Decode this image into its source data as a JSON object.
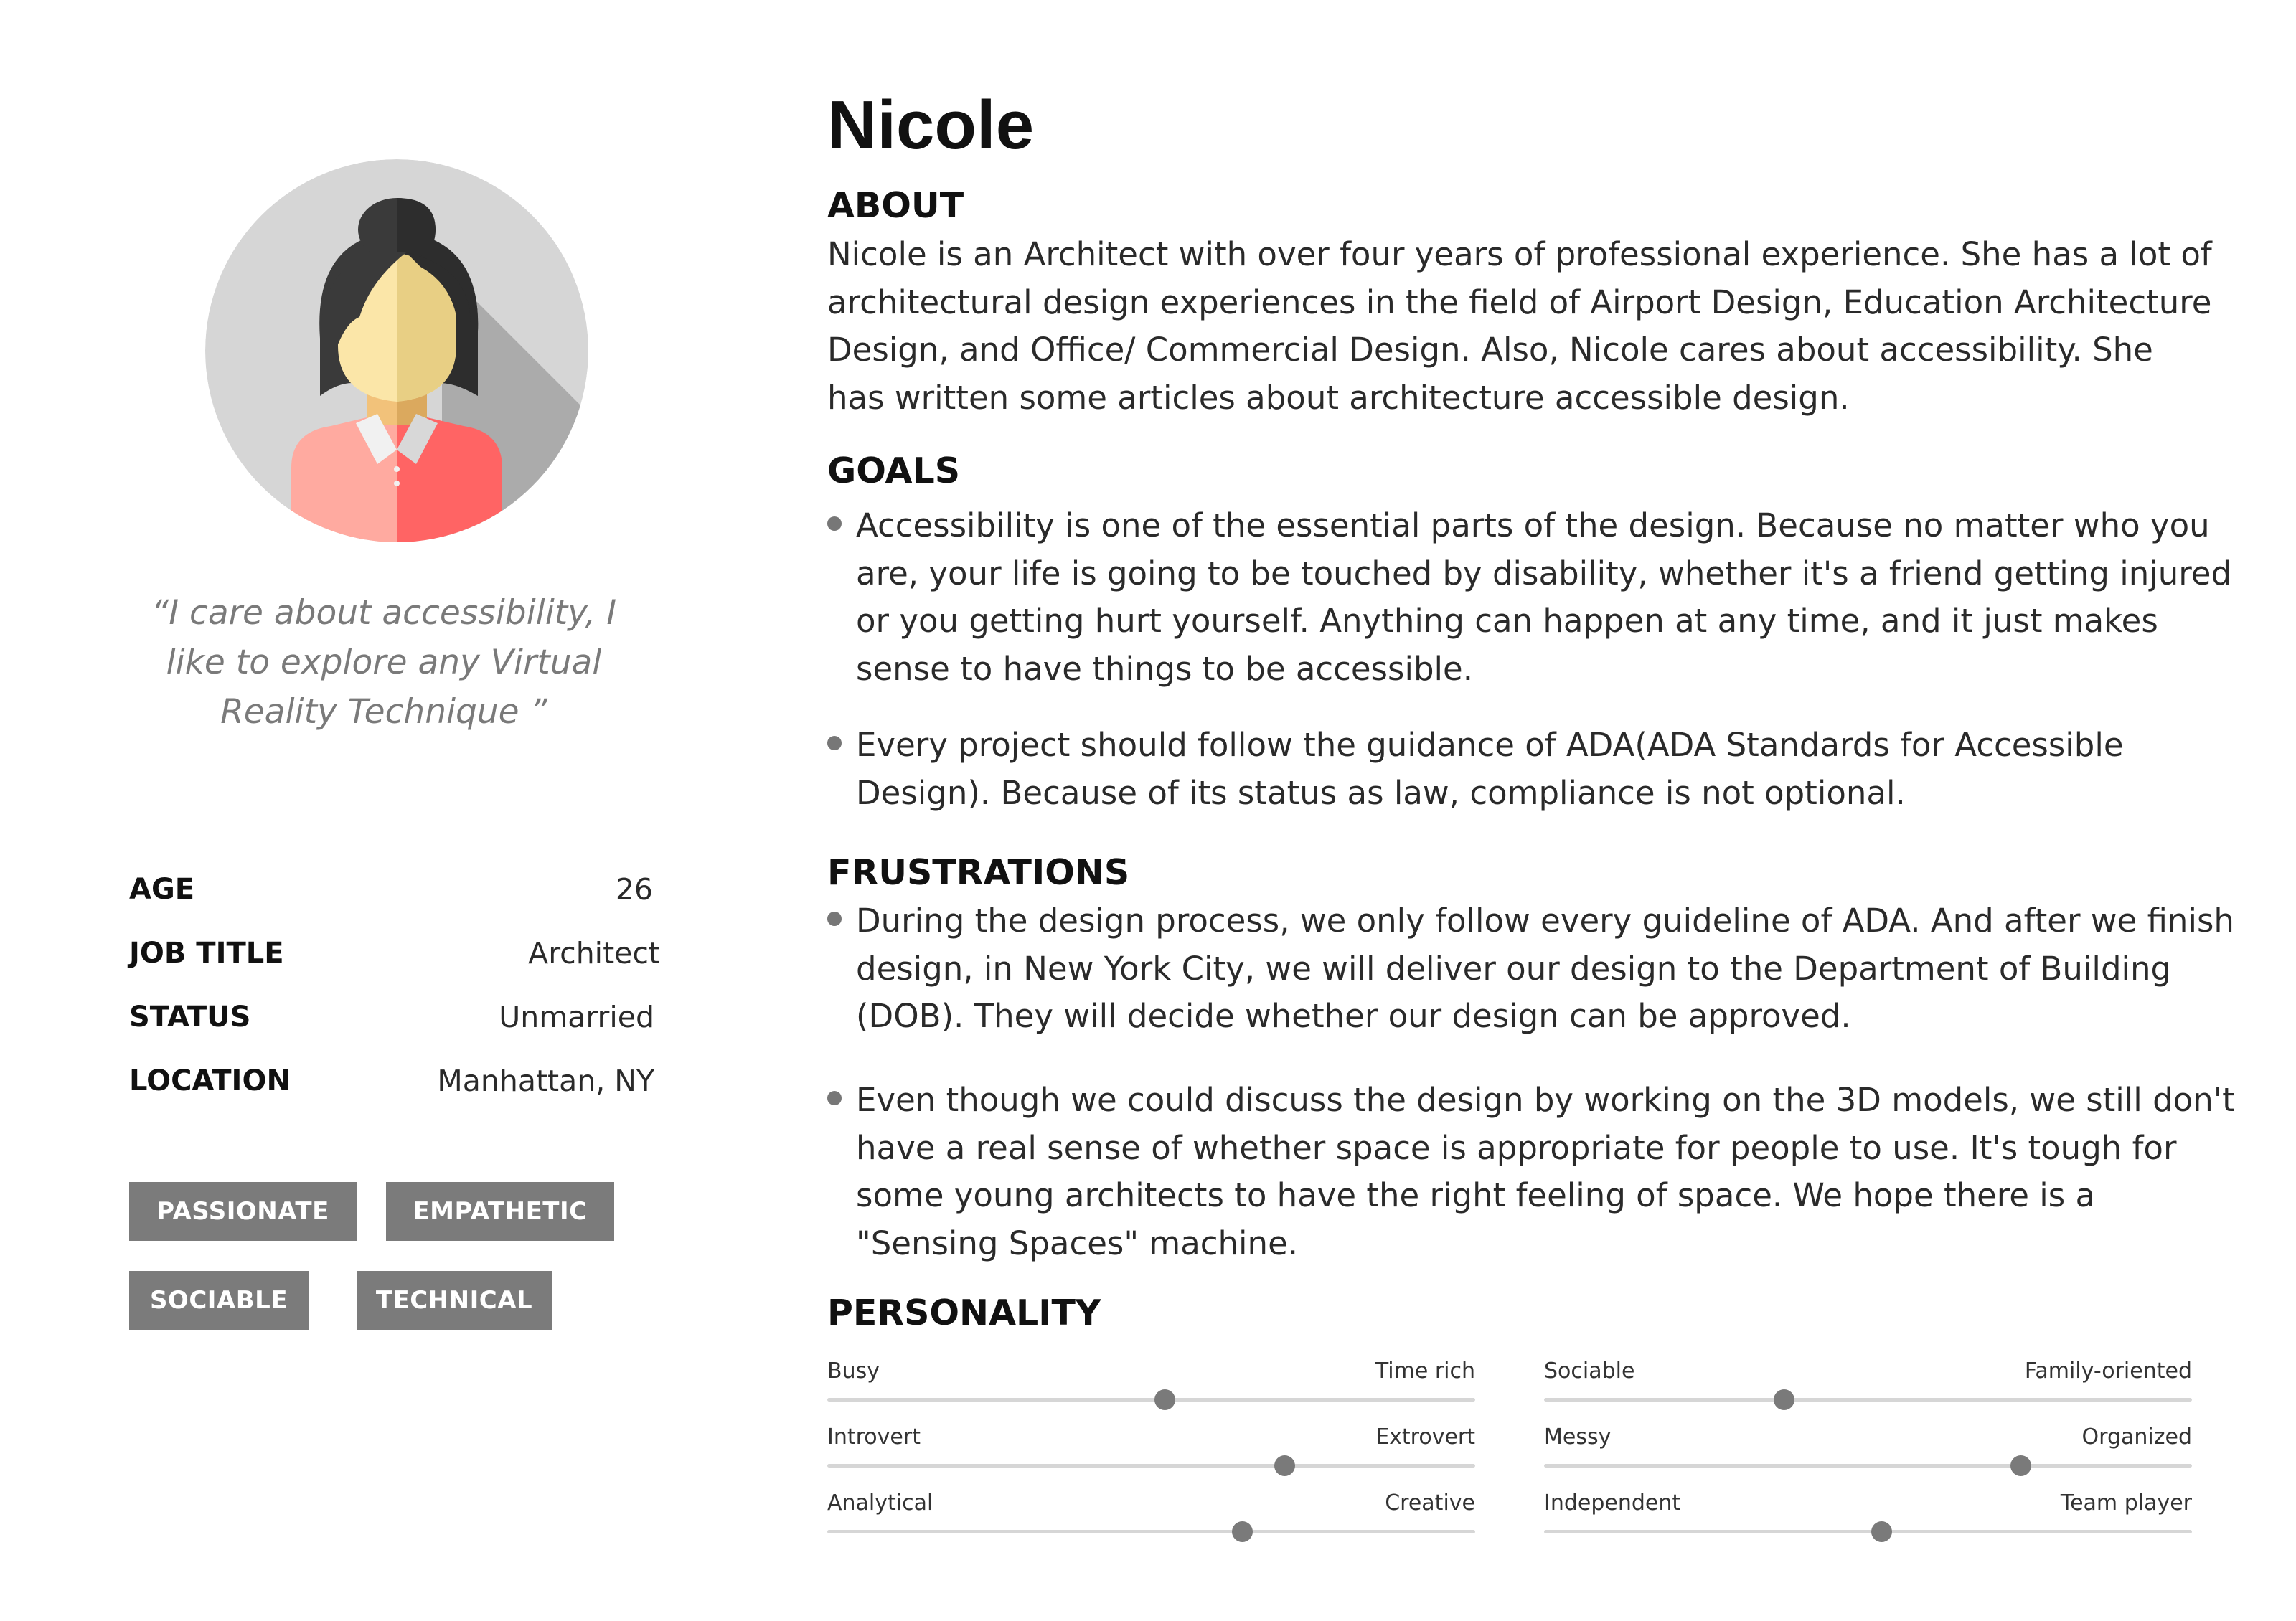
{
  "persona": {
    "name": "Nicole",
    "quote": "“I care about accessibility, I like to explore any Virtual Reality Technique ”"
  },
  "facts": [
    {
      "key": "AGE",
      "value": "26"
    },
    {
      "key": "JOB TITLE",
      "value": "Architect"
    },
    {
      "key": "STATUS",
      "value": "Unmarried"
    },
    {
      "key": "LOCATION",
      "value": "Manhattan, NY"
    }
  ],
  "tags": [
    "PASSIONATE",
    "EMPATHETIC",
    "SOCIABLE",
    "TECHNICAL"
  ],
  "about": {
    "heading": "ABOUT",
    "text": "Nicole is an Architect with over four years of professional experience. She has a lot of architectural design experiences in the field of Airport Design, Education Architecture Design, and Office/ Commercial Design. Also, Nicole cares about accessibility. She has written some articles about architecture accessible design."
  },
  "goals": {
    "heading": "GOALS",
    "items": [
      "Accessibility is one of the essential parts of the design. Because no matter who you are, your life is going to be touched by disability, whether it's a friend getting injured or you getting hurt yourself. Anything can happen at any time, and it just makes sense to have things to be accessible.",
      "Every project should follow the guidance of ADA(ADA Standards for Accessible Design). Because of its status as law, compliance is not optional."
    ]
  },
  "frustrations": {
    "heading": "FRUSTRATIONS",
    "items": [
      "During the design process, we only follow every guideline of ADA. And after we finish design, in New York City,  we will deliver our design to the Department of Building (DOB). They will decide whether our design can be approved.",
      "Even though we could discuss the design by working on the 3D models, we still don't have a real sense of whether space is appropriate for people to use. It's tough for some young architects to have the right feeling of space. We hope there is a \"Sensing Spaces\" machine."
    ]
  },
  "personality": {
    "heading": "PERSONALITY",
    "traits": [
      {
        "left": "Busy",
        "right": "Time rich",
        "value": 0.52
      },
      {
        "left": "Sociable",
        "right": "Family-oriented",
        "value": 0.37
      },
      {
        "left": "Introvert",
        "right": "Extrovert",
        "value": 0.705
      },
      {
        "left": "Messy",
        "right": "Organized",
        "value": 0.735
      },
      {
        "left": "Analytical",
        "right": "Creative",
        "value": 0.64
      },
      {
        "left": "Independent",
        "right": "Team player",
        "value": 0.52
      }
    ]
  },
  "colors": {
    "avatar_bg": "#d6d6d6",
    "avatar_shadow": "#ababab",
    "hair": "#3a3a3a",
    "skin": "#fbe6a8",
    "skin_shade": "#e8cf84",
    "shirt_light": "#ffaaa0",
    "shirt_dark": "#ff6464",
    "tag_bg": "#7b7b7b",
    "slider_knob": "#7a7a7a",
    "slider_track": "#d6d6d6"
  }
}
